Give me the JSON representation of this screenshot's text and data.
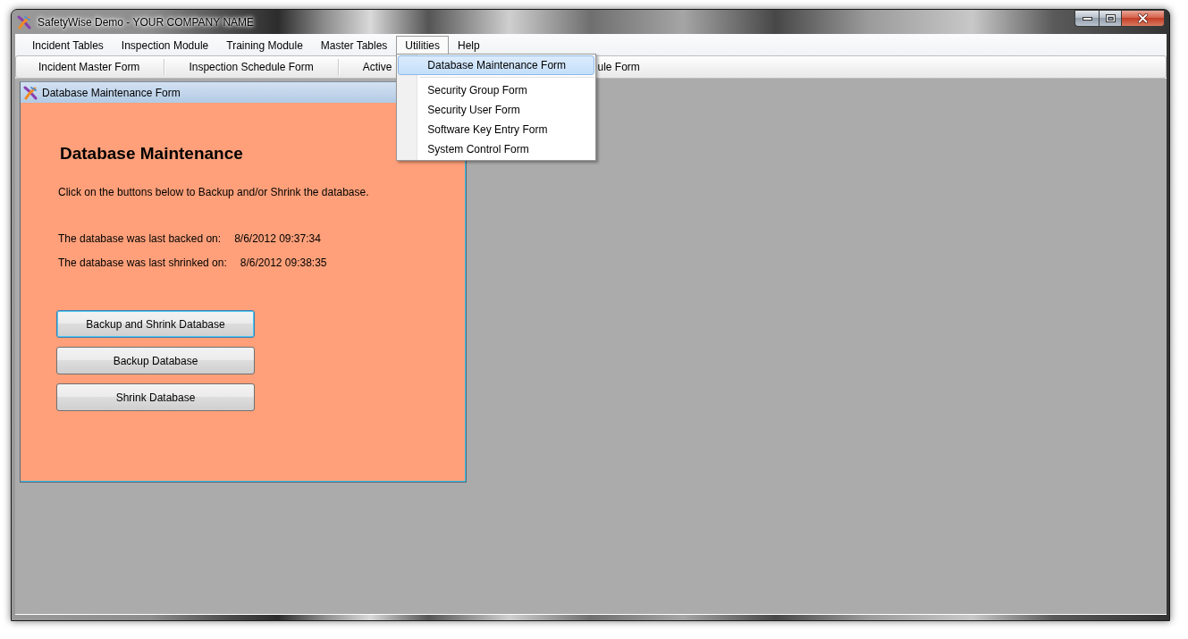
{
  "window": {
    "title": "SafetyWise Demo - YOUR COMPANY NAME"
  },
  "menu_bar": [
    {
      "label": "Incident Tables",
      "selected": false
    },
    {
      "label": "Inspection Module",
      "selected": false
    },
    {
      "label": "Training Module",
      "selected": false
    },
    {
      "label": "Master Tables",
      "selected": false
    },
    {
      "label": "Utilities",
      "selected": true
    },
    {
      "label": "Help",
      "selected": false
    }
  ],
  "toolbar": [
    {
      "kind": "full",
      "label": "Incident Master Form"
    },
    {
      "kind": "full",
      "label": "Inspection Schedule Form"
    },
    {
      "kind": "covered",
      "label_parts": [
        "Active",
        "ule Form"
      ]
    }
  ],
  "open_menu": {
    "items": [
      {
        "kind": "item",
        "label": "Database Maintenance Form",
        "selected": true
      },
      {
        "kind": "separator"
      },
      {
        "kind": "item",
        "label": "Security Group Form",
        "selected": false
      },
      {
        "kind": "item",
        "label": "Security User Form",
        "selected": false
      },
      {
        "kind": "item",
        "label": "Software Key Entry Form",
        "selected": false
      },
      {
        "kind": "item",
        "label": "System Control Form",
        "selected": false
      }
    ]
  },
  "child_window": {
    "title": "Database Maintenance Form",
    "heading": "Database Maintenance",
    "instructions": "Click on the buttons below to Backup and/or Shrink the database.",
    "info_rows": [
      {
        "label": "The database was last backed on:",
        "value": "8/6/2012 09:37:34"
      },
      {
        "label": "The database was last shrinked on:",
        "value": "8/6/2012 09:38:35"
      }
    ],
    "buttons": [
      {
        "label": "Backup and Shrink Database",
        "focused": true
      },
      {
        "label": "Backup Database",
        "focused": false
      },
      {
        "label": "Shrink Database",
        "focused": false
      }
    ]
  }
}
